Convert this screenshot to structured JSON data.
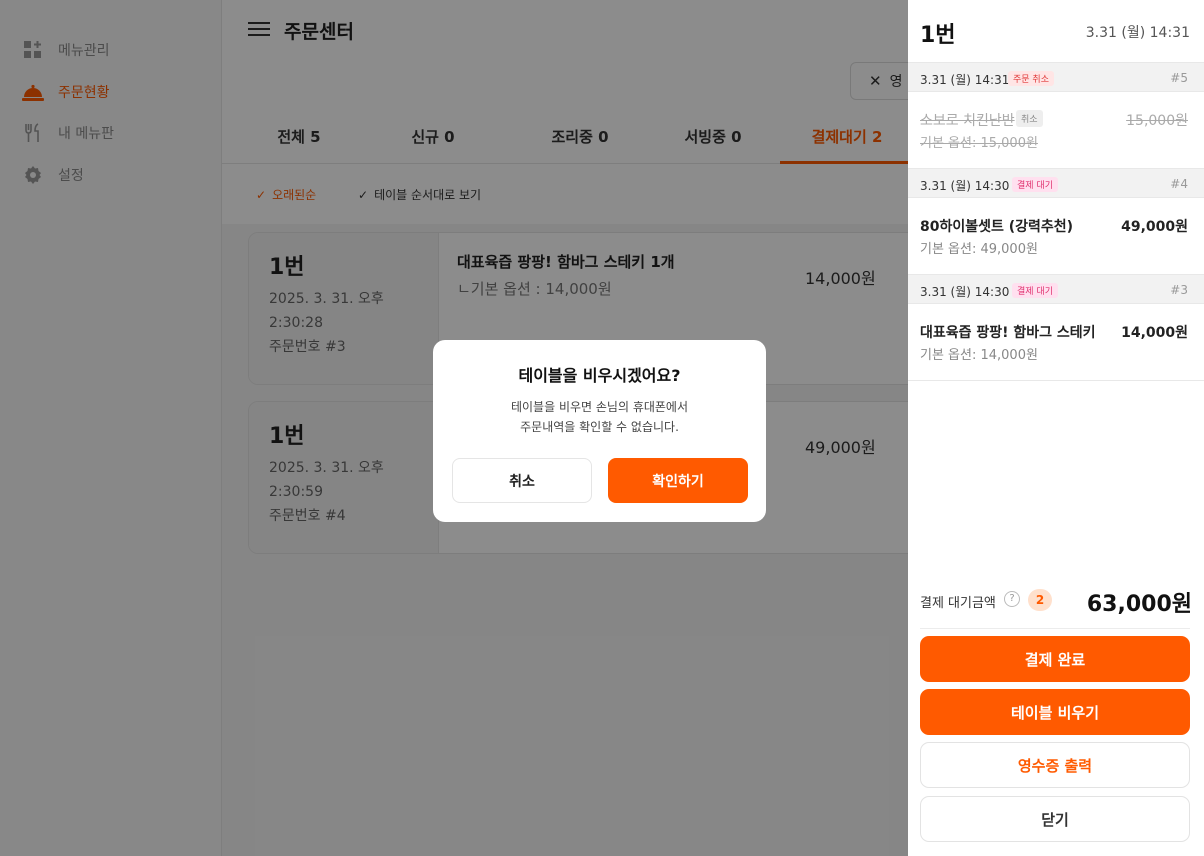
{
  "sidebar": {
    "items": [
      {
        "label": "메뉴관리",
        "icon": "grid-plus-icon"
      },
      {
        "label": "주문현황",
        "icon": "cloche-icon",
        "active": true
      },
      {
        "label": "내 메뉴판",
        "icon": "fork-knife-icon"
      },
      {
        "label": "설정",
        "icon": "gear-icon"
      }
    ]
  },
  "header": {
    "title": "주문센터",
    "close_label": "영"
  },
  "tabs": [
    {
      "label": "전체 5"
    },
    {
      "label": "신규 0"
    },
    {
      "label": "조리중 0"
    },
    {
      "label": "서빙중 0"
    },
    {
      "label": "결제대기 2",
      "active": true
    }
  ],
  "filters": {
    "sort_old": "오래된순",
    "sort_table": "테이블 순서대로 보기"
  },
  "orders": [
    {
      "table": "1번",
      "date": "2025. 3. 31. 오후",
      "time": "2:30:28",
      "order_no": "주문번호 #3",
      "item": "대표육즙 팡팡! 함바그 스테키 1개",
      "option": "ㄴ기본 옵션 : 14,000원",
      "price": "14,000원"
    },
    {
      "table": "1번",
      "date": "2025. 3. 31. 오후",
      "time": "2:30:59",
      "order_no": "주문번호 #4",
      "item": "",
      "option": "",
      "price": "49,000원"
    }
  ],
  "panel": {
    "title": "1번",
    "time": "3.31 (월) 14:31",
    "groups": [
      {
        "time": "3.31 (월) 14:31",
        "badge": "주문 취소",
        "badge_type": "cancel",
        "no": "#5",
        "name": "소보로 치킨난반",
        "tag": "취소",
        "option": "기본 옵션: 15,000원",
        "price": "15,000원",
        "canceled": true
      },
      {
        "time": "3.31 (월) 14:30",
        "badge": "결제 대기",
        "badge_type": "wait",
        "no": "#4",
        "name": "80하이볼셋트 (강력추천)",
        "option": "기본 옵션: 49,000원",
        "price": "49,000원"
      },
      {
        "time": "3.31 (월) 14:30",
        "badge": "결제 대기",
        "badge_type": "wait",
        "no": "#3",
        "name": "대표육즙 팡팡! 함바그 스테키",
        "option": "기본 옵션: 14,000원",
        "price": "14,000원"
      }
    ],
    "total_label": "결제 대기금액",
    "help": "?",
    "count": "2",
    "total": "63,000원",
    "buttons": {
      "pay_done": "결제 완료",
      "clear_table": "테이블 비우기",
      "print_receipt": "영수증 출력",
      "close": "닫기"
    }
  },
  "modal": {
    "title": "테이블을 비우시겠어요?",
    "desc_line1": "테이블을 비우면 손님의 휴대폰에서",
    "desc_line2": "주문내역을 확인할 수 없습니다.",
    "cancel": "취소",
    "confirm": "확인하기"
  },
  "colors": {
    "accent": "#ff5a00",
    "cancel_badge": "#e03a3a",
    "wait_badge": "#e0326f"
  }
}
